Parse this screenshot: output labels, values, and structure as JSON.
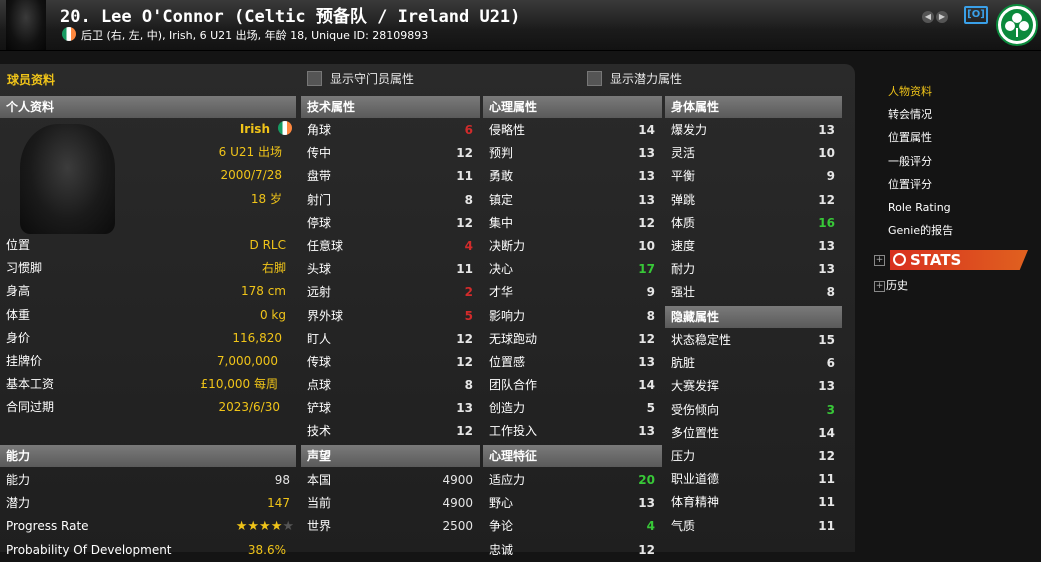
{
  "header": {
    "title": "20. Lee O'Connor (Celtic 预备队 / Ireland U21)",
    "subtitle": "后卫 (右, 左, 中), Irish, 6 U21 出场, 年龄 18, Unique ID: 28109893",
    "camera_label": "[O]"
  },
  "panel": {
    "title": "球员资料",
    "toggle_gk": "显示守门员属性",
    "toggle_potential": "显示潜力属性"
  },
  "sections": {
    "personal": "个人资料",
    "technical": "技术属性",
    "mental": "心理属性",
    "physical": "身体属性",
    "hidden": "隐藏属性",
    "ability": "能力",
    "reputation": "声望",
    "traits": "心理特征"
  },
  "personal": {
    "nationality": "Irish",
    "caps": "6 U21 出场",
    "dob": "2000/7/28",
    "age": "18 岁",
    "rows": [
      {
        "label": "位置",
        "value": "D RLC"
      },
      {
        "label": "习惯脚",
        "value": "右脚"
      },
      {
        "label": "身高",
        "value": "178 cm"
      },
      {
        "label": "体重",
        "value": "0 kg"
      },
      {
        "label": "身价",
        "value": "116,820"
      },
      {
        "label": "挂牌价",
        "value": "7,000,000"
      },
      {
        "label": "基本工资",
        "value": "£10,000 每周"
      },
      {
        "label": "合同过期",
        "value": "2023/6/30"
      }
    ]
  },
  "ability": {
    "rows": [
      {
        "label": "能力",
        "value": "98"
      },
      {
        "label": "潜力",
        "value": "147"
      },
      {
        "label": "Progress Rate",
        "value": ""
      },
      {
        "label": "Probability Of Development",
        "value": "38.6%"
      }
    ],
    "progress_rate_stars": 4,
    "progress_rate_max": 5
  },
  "technical": [
    {
      "label": "角球",
      "value": "6",
      "color": "#d22b2b"
    },
    {
      "label": "传中",
      "value": "12",
      "color": "#e6e6e6"
    },
    {
      "label": "盘带",
      "value": "11",
      "color": "#e6e6e6"
    },
    {
      "label": "射门",
      "value": "8",
      "color": "#e6e6e6"
    },
    {
      "label": "停球",
      "value": "12",
      "color": "#e6e6e6"
    },
    {
      "label": "任意球",
      "value": "4",
      "color": "#d22b2b"
    },
    {
      "label": "头球",
      "value": "11",
      "color": "#e6e6e6"
    },
    {
      "label": "远射",
      "value": "2",
      "color": "#d22b2b"
    },
    {
      "label": "界外球",
      "value": "5",
      "color": "#d22b2b"
    },
    {
      "label": "盯人",
      "value": "12",
      "color": "#e6e6e6"
    },
    {
      "label": "传球",
      "value": "12",
      "color": "#e6e6e6"
    },
    {
      "label": "点球",
      "value": "8",
      "color": "#e6e6e6"
    },
    {
      "label": "铲球",
      "value": "13",
      "color": "#e6e6e6"
    },
    {
      "label": "技术",
      "value": "12",
      "color": "#e6e6e6"
    }
  ],
  "reputation": [
    {
      "label": "本国",
      "value": "4900"
    },
    {
      "label": "当前",
      "value": "4900"
    },
    {
      "label": "世界",
      "value": "2500"
    }
  ],
  "mental": [
    {
      "label": "侵略性",
      "value": "14",
      "color": "#e6e6e6"
    },
    {
      "label": "预判",
      "value": "13",
      "color": "#e6e6e6"
    },
    {
      "label": "勇敢",
      "value": "13",
      "color": "#e6e6e6"
    },
    {
      "label": "镇定",
      "value": "13",
      "color": "#e6e6e6"
    },
    {
      "label": "集中",
      "value": "12",
      "color": "#e6e6e6"
    },
    {
      "label": "决断力",
      "value": "10",
      "color": "#e6e6e6"
    },
    {
      "label": "决心",
      "value": "17",
      "color": "#38c838"
    },
    {
      "label": "才华",
      "value": "9",
      "color": "#e6e6e6"
    },
    {
      "label": "影响力",
      "value": "8",
      "color": "#e6e6e6"
    },
    {
      "label": "无球跑动",
      "value": "12",
      "color": "#e6e6e6"
    },
    {
      "label": "位置感",
      "value": "13",
      "color": "#e6e6e6"
    },
    {
      "label": "团队合作",
      "value": "14",
      "color": "#e6e6e6"
    },
    {
      "label": "创造力",
      "value": "5",
      "color": "#e6e6e6"
    },
    {
      "label": "工作投入",
      "value": "13",
      "color": "#e6e6e6"
    }
  ],
  "traits": [
    {
      "label": "适应力",
      "value": "20",
      "color": "#38c838"
    },
    {
      "label": "野心",
      "value": "13",
      "color": "#e6e6e6"
    },
    {
      "label": "争论",
      "value": "4",
      "color": "#38c838"
    },
    {
      "label": "忠诚",
      "value": "12",
      "color": "#e6e6e6"
    }
  ],
  "physical": [
    {
      "label": "爆发力",
      "value": "13",
      "color": "#e6e6e6"
    },
    {
      "label": "灵活",
      "value": "10",
      "color": "#e6e6e6"
    },
    {
      "label": "平衡",
      "value": "9",
      "color": "#e6e6e6"
    },
    {
      "label": "弹跳",
      "value": "12",
      "color": "#e6e6e6"
    },
    {
      "label": "体质",
      "value": "16",
      "color": "#38c838"
    },
    {
      "label": "速度",
      "value": "13",
      "color": "#e6e6e6"
    },
    {
      "label": "耐力",
      "value": "13",
      "color": "#e6e6e6"
    },
    {
      "label": "强壮",
      "value": "8",
      "color": "#e6e6e6"
    }
  ],
  "hidden": [
    {
      "label": "状态稳定性",
      "value": "15",
      "color": "#e6e6e6"
    },
    {
      "label": "肮脏",
      "value": "6",
      "color": "#e6e6e6"
    },
    {
      "label": "大赛发挥",
      "value": "13",
      "color": "#e6e6e6"
    },
    {
      "label": "受伤倾向",
      "value": "3",
      "color": "#38c838"
    },
    {
      "label": "多位置性",
      "value": "14",
      "color": "#e6e6e6"
    },
    {
      "label": "压力",
      "value": "12",
      "color": "#e6e6e6"
    },
    {
      "label": "职业道德",
      "value": "11",
      "color": "#e6e6e6"
    },
    {
      "label": "体育精神",
      "value": "11",
      "color": "#e6e6e6"
    },
    {
      "label": "气质",
      "value": "11",
      "color": "#e6e6e6"
    }
  ],
  "sidebar": {
    "items": [
      "人物资料",
      "转会情况",
      "位置属性",
      "一般评分",
      "位置评分",
      "Role Rating",
      "Genie的报告"
    ],
    "stats_label": "STATS",
    "history_label": "历史",
    "expander_symbol": "+"
  },
  "colors": {
    "accent_yellow": "#f0c419",
    "low_red": "#d22b2b",
    "high_green": "#38c838",
    "stats_orange": "#d8301f",
    "club_green": "#0b8a3c"
  }
}
